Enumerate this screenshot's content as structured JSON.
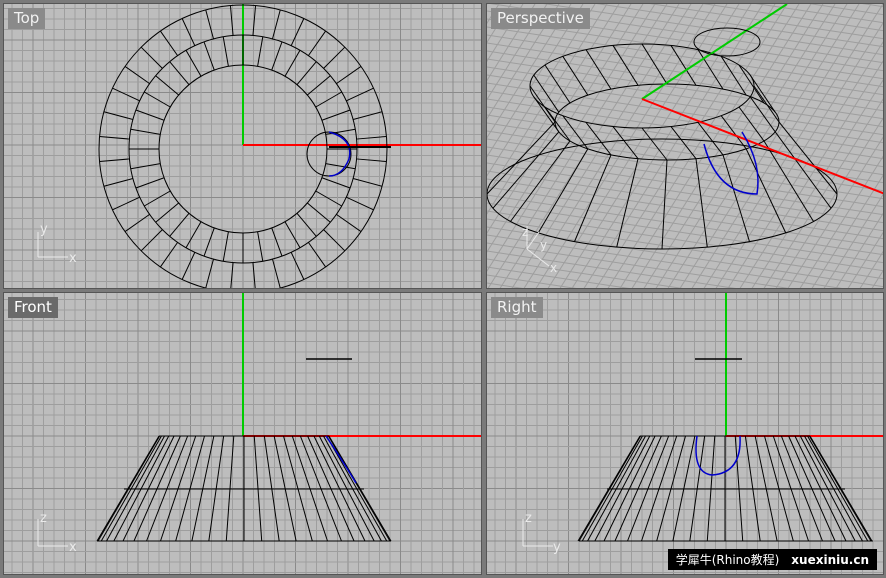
{
  "viewports": {
    "top": {
      "title": "Top",
      "axis_h": "x",
      "axis_v": "y"
    },
    "perspective": {
      "title": "Perspective",
      "axis_h": "x",
      "axis_v": "y",
      "axis_z": "z"
    },
    "front": {
      "title": "Front",
      "axis_h": "x",
      "axis_v": "z"
    },
    "right": {
      "title": "Right",
      "axis_h": "y",
      "axis_v": "z"
    }
  },
  "watermark": {
    "text": "学犀牛(Rhino教程)",
    "site": "xuexiniu.cn"
  },
  "colors": {
    "grid_bg": "#bdbdbd",
    "grid_line": "#9e9e9e",
    "grid_major": "#8a8a8a",
    "x_axis": "#ff0000",
    "y_axis": "#00cc00",
    "curve_selected": "#0000cc",
    "wire": "#000000"
  }
}
